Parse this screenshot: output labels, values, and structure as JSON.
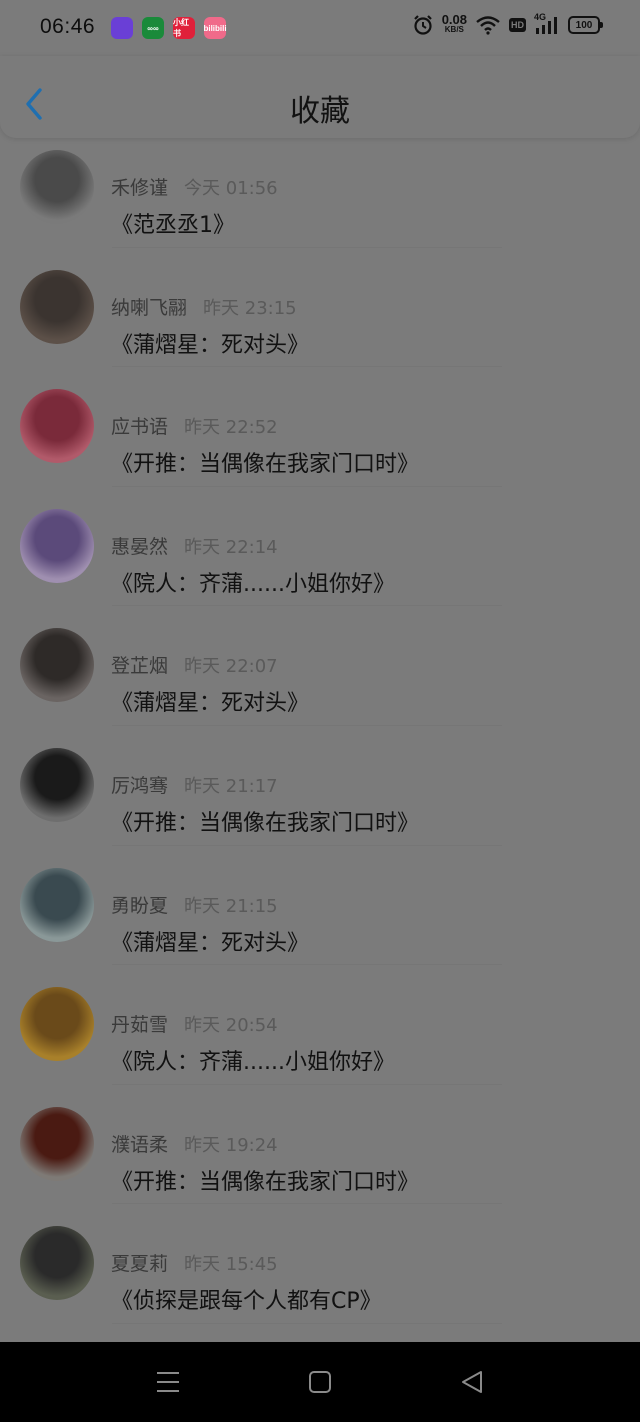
{
  "status": {
    "time": "06:46",
    "speed_value": "0.08",
    "speed_unit": "KB/S",
    "hd": "HD",
    "network": "4G",
    "battery": "100",
    "app_icons": [
      {
        "name": "app-icon-purple",
        "color": "#6a3fd6",
        "text": ""
      },
      {
        "name": "app-icon-green",
        "color": "#1a8a3a",
        "text": "∞∞"
      },
      {
        "name": "app-icon-red",
        "color": "#e0203a",
        "text": "小红书"
      },
      {
        "name": "app-icon-pink",
        "color": "#f06a8a",
        "text": "bilibili"
      }
    ]
  },
  "header": {
    "title": "收藏"
  },
  "items": [
    {
      "user": "禾修谨",
      "time": "今天 01:56",
      "quote": "《范丞丞1》",
      "avatar_color": "#4a4a4a",
      "avatar_bg": "#7a7a7a"
    },
    {
      "user": "纳喇飞翮",
      "time": "昨天 23:15",
      "quote": "《蒲熠星：死对头》",
      "avatar_color": "#3b3430",
      "avatar_bg": "#5c5048"
    },
    {
      "user": "应书语",
      "time": "昨天 22:52",
      "quote": "《开推：当偶像在我家门口时》",
      "avatar_color": "#7a2a3a",
      "avatar_bg": "#b15a6a"
    },
    {
      "user": "惠晏然",
      "time": "昨天 22:14",
      "quote": "《院人：齐蒲......小姐你好》",
      "avatar_color": "#5b4a7a",
      "avatar_bg": "#9f8fb0"
    },
    {
      "user": "登芷烟",
      "time": "昨天 22:07",
      "quote": "《蒲熠星：死对头》",
      "avatar_color": "#2e2a28",
      "avatar_bg": "#6a6462"
    },
    {
      "user": "厉鸿骞",
      "time": "昨天 21:17",
      "quote": "《开推：当偶像在我家门口时》",
      "avatar_color": "#1a1a1a",
      "avatar_bg": "#6e6e6e"
    },
    {
      "user": "勇盼夏",
      "time": "昨天 21:15",
      "quote": "《蒲熠星：死对头》",
      "avatar_color": "#3a4a50",
      "avatar_bg": "#8a9898"
    },
    {
      "user": "丹茹雪",
      "time": "昨天 20:54",
      "quote": "《院人：齐蒲......小姐你好》",
      "avatar_color": "#6a4a1a",
      "avatar_bg": "#a8802a"
    },
    {
      "user": "濮语柔",
      "time": "昨天 19:24",
      "quote": "《开推：当偶像在我家门口时》",
      "avatar_color": "#4a1a12",
      "avatar_bg": "#7e7a76"
    },
    {
      "user": "夏夏莉",
      "time": "昨天 15:45",
      "quote": "《侦探是跟每个人都有CP》",
      "avatar_color": "#2a2a2a",
      "avatar_bg": "#5a5e50"
    }
  ],
  "colors": {
    "accent": "#1f6fb0",
    "background": "#7b7b7b"
  }
}
